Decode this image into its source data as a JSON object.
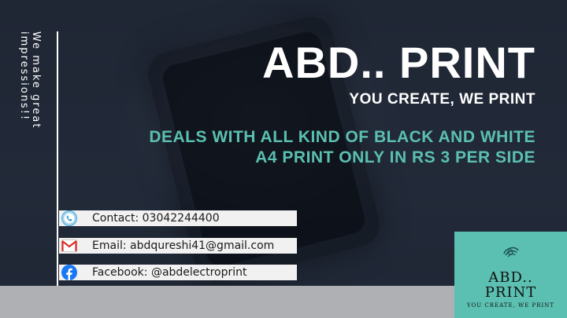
{
  "tagline_vertical": "We make great impressions!!",
  "brand": {
    "title": "ABD.. PRINT",
    "tagline": "YOU CREATE, WE PRINT"
  },
  "deal": {
    "line1": "DEALS WITH ALL KIND OF BLACK AND WHITE",
    "line2": "A4 PRINT ONLY IN RS 3 PER SIDE"
  },
  "contacts": {
    "contact": "Contact:  03042244400",
    "email": "Email:  abdqureshi41@gmail.com",
    "facebook": "Facebook:  @abdelectroprint"
  },
  "logo": {
    "name": "ABD..\nPRINT",
    "subtitle": "YOU CREATE, WE PRINT"
  },
  "colors": {
    "background": "#1e2533",
    "accent": "#5bc0b1",
    "band": "#aeb0b3",
    "row": "#f1f1f1"
  },
  "icons": {
    "contact": "phone-icon",
    "email": "gmail-icon",
    "facebook": "facebook-icon",
    "logo": "logo-mark-icon"
  }
}
